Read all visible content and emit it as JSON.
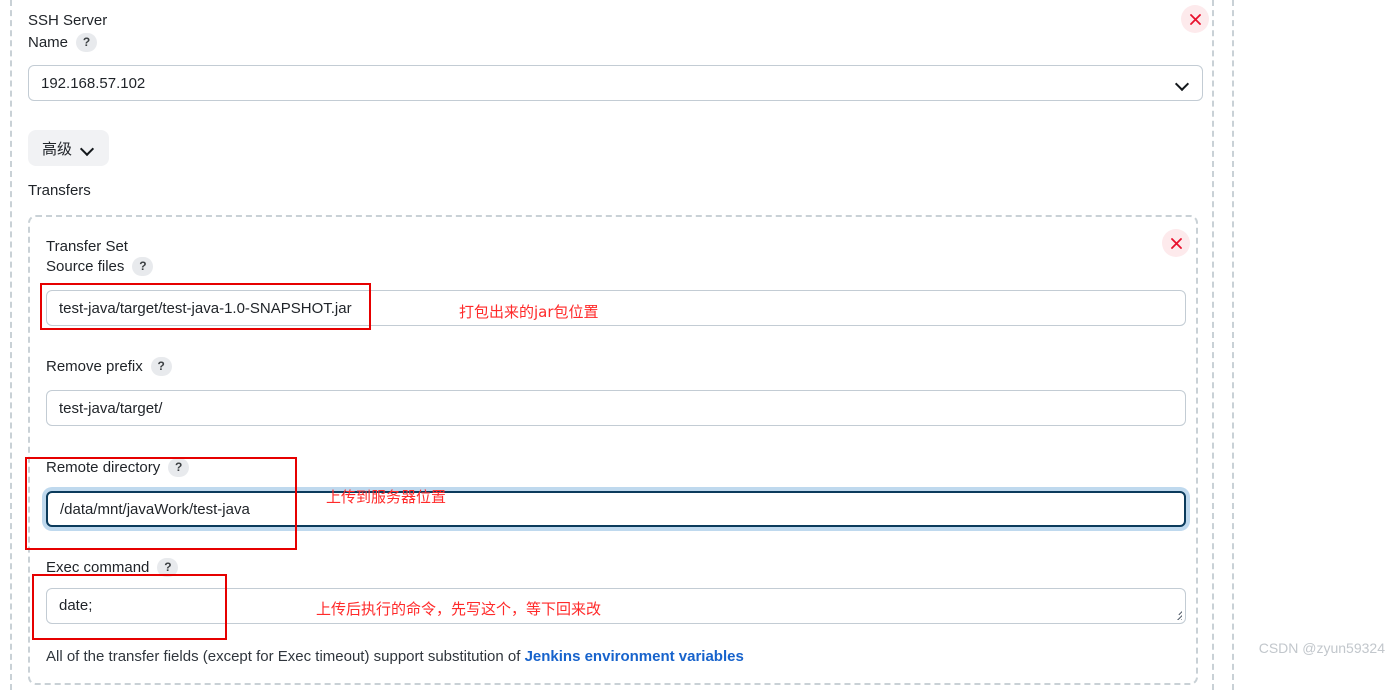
{
  "form": {
    "ssh_server_label_line1": "SSH Server",
    "ssh_server_label_line2": "Name",
    "ssh_server_value": "192.168.57.102",
    "close_ssh_server_title": "×",
    "advanced_button_label": "高级",
    "transfers_label": "Transfers"
  },
  "transfer_set": {
    "title": "Transfer Set",
    "close_title": "×",
    "source_files": {
      "label": "Source files",
      "value": "test-java/target/test-java-1.0-SNAPSHOT.jar"
    },
    "remove_prefix": {
      "label": "Remove prefix",
      "value": "test-java/target/"
    },
    "remote_directory": {
      "label": "Remote directory",
      "value": "/data/mnt/javaWork/test-java"
    },
    "exec_command": {
      "label": "Exec command",
      "value": "date;"
    },
    "help_badge": "?"
  },
  "annotations": [
    {
      "name": "source-files-note",
      "text": "打包出来的jar包位置"
    },
    {
      "name": "remote-directory-note",
      "text": "上传到服务器位置"
    },
    {
      "name": "exec-command-note",
      "text": "上传后执行的命令，先写这个，等下回来改"
    }
  ],
  "footer": {
    "text_before_link": "All of the transfer fields (except for Exec timeout) support substitution of ",
    "link_text": "Jenkins environment variables"
  },
  "watermark": {
    "text": "CSDN @zyun59324"
  },
  "colors": {
    "annotation_red": "#ff2a2a",
    "annotation_box_red": "#e60000",
    "focus_border": "#0b3b5c",
    "focus_ring": "#bfd9ee",
    "link_blue": "#1763cc",
    "dashed_border": "#c9d1d6"
  }
}
